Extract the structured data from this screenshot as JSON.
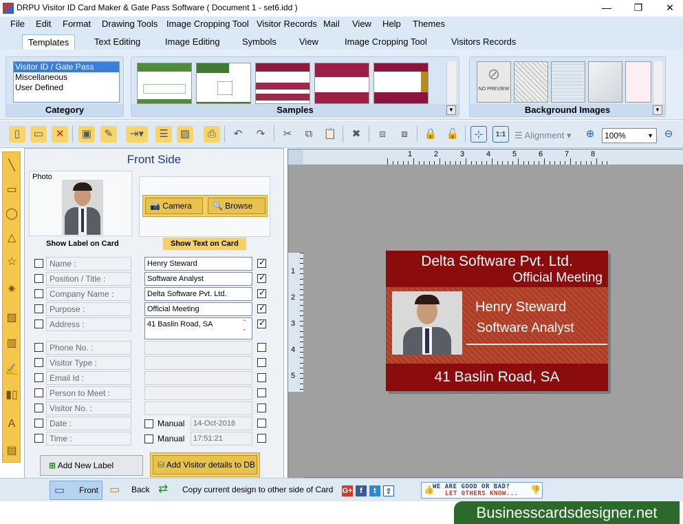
{
  "window": {
    "title": "DRPU Visitor ID Card Maker & Gate Pass Software ( Document 1 - set6.idd )",
    "controls": [
      "—",
      "❐",
      "✕"
    ]
  },
  "menu": [
    "File",
    "Edit",
    "Format",
    "Drawing Tools",
    "Image Cropping Tool",
    "Visitor Records",
    "Mail",
    "View",
    "Help",
    "Themes"
  ],
  "tabs": [
    "Templates",
    "Text Editing",
    "Image Editing",
    "Symbols",
    "View",
    "Image Cropping Tool",
    "Visitors Records"
  ],
  "ribbon": {
    "category": {
      "label": "Category",
      "items": [
        "Visitor ID / Gate Pass",
        "Miscellaneous",
        "User Defined"
      ]
    },
    "samples": {
      "label": "Samples"
    },
    "background": {
      "label": "Background Images",
      "no_preview": "NO PREVIEW"
    }
  },
  "toolbar": {
    "alignment_label": "Alignment",
    "zoom_value": "100%"
  },
  "panel": {
    "title": "Front Side",
    "photo_label": "Photo",
    "camera_label": "Camera",
    "browse_label": "Browse",
    "show_label_heading": "Show Label on Card",
    "show_text_heading": "Show Text on Card",
    "fields": [
      {
        "label": "Name :",
        "value": "Henry Steward",
        "label_on": false,
        "text_on": true
      },
      {
        "label": "Position / Title :",
        "value": "Software Analyst",
        "label_on": false,
        "text_on": true
      },
      {
        "label": "Company Name :",
        "value": "Delta Software Pvt. Ltd.",
        "label_on": false,
        "text_on": true
      },
      {
        "label": "Purpose :",
        "value": "Official Meeting",
        "label_on": false,
        "text_on": true
      },
      {
        "label": "Address :",
        "value": "41 Baslin Road, SA",
        "label_on": false,
        "text_on": true
      },
      {
        "label": "Phone No. :",
        "value": "",
        "label_on": false,
        "text_on": false
      },
      {
        "label": "Visitor Type :",
        "value": "",
        "label_on": false,
        "text_on": false
      },
      {
        "label": "Email Id :",
        "value": "",
        "label_on": false,
        "text_on": false
      },
      {
        "label": "Person to Meet :",
        "value": "",
        "label_on": false,
        "text_on": false
      },
      {
        "label": "Visitor No. :",
        "value": "",
        "label_on": false,
        "text_on": false
      },
      {
        "label": "Date :",
        "value": "14-Oct-2016",
        "label_on": false,
        "text_on": false,
        "manual": "Manual"
      },
      {
        "label": "Time :",
        "value": "17:51:21",
        "label_on": false,
        "text_on": false,
        "manual": "Manual"
      }
    ],
    "add_label_button": "Add New Label",
    "add_db_button": "Add Visitor details to DB"
  },
  "rulers": {
    "h": [
      "1",
      "2",
      "3",
      "4",
      "5",
      "6",
      "7",
      "8"
    ],
    "v": [
      "1",
      "2",
      "3",
      "4",
      "5"
    ]
  },
  "card": {
    "company": "Delta Software Pvt. Ltd.",
    "purpose": "Official Meeting",
    "name": "Henry Steward",
    "position": "Software Analyst",
    "address": "41 Baslin Road, SA",
    "colors": {
      "header": "#8b0c0c",
      "body": "#b4452e",
      "footer": "#8b0c0c"
    }
  },
  "statusbar": {
    "front": "Front",
    "back": "Back",
    "copy": "Copy current design to other side of Card",
    "social": [
      "G+",
      "f",
      "t",
      "⇪"
    ],
    "feedback": {
      "line1": "WE ARE GOOD OR BAD?",
      "line2": "LET OTHERS KNOW..."
    }
  },
  "brand": "Businesscardsdesigner.net"
}
